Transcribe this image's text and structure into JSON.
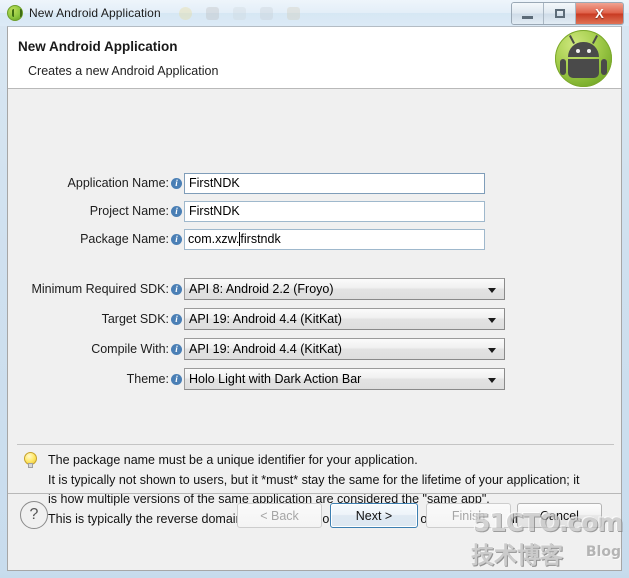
{
  "window": {
    "title": "New Android Application",
    "icon": "android-round-icon",
    "buttons": {
      "minimize": "minimize-icon",
      "maximize": "maximize-icon",
      "close": "X"
    }
  },
  "dialog": {
    "heading": "New Android Application",
    "subheading": "Creates a new Android Application",
    "logo": "android-mascot-logo"
  },
  "fields": [
    {
      "label": "Application Name:",
      "value": "FirstNDK",
      "type": "text",
      "name": "application-name"
    },
    {
      "label": "Project Name:",
      "value": "FirstNDK",
      "type": "text",
      "name": "project-name"
    },
    {
      "label": "Package Name:",
      "value_before_caret": "com.xzw.",
      "value_after_caret": "firstndk",
      "type": "text",
      "name": "package-name"
    }
  ],
  "combos": [
    {
      "label": "Minimum Required SDK:",
      "value": "API 8: Android 2.2 (Froyo)",
      "name": "minimum-required-sdk"
    },
    {
      "label": "Target SDK:",
      "value": "API 19: Android 4.4 (KitKat)",
      "name": "target-sdk"
    },
    {
      "label": "Compile With:",
      "value": "API 19: Android 4.4 (KitKat)",
      "name": "compile-with"
    },
    {
      "label": "Theme:",
      "value": "Holo Light with Dark Action Bar",
      "name": "theme"
    }
  ],
  "hint": {
    "icon": "lightbulb-icon",
    "lines": [
      "The package name must be a unique identifier for your application.",
      "It is typically not shown to users, but it *must* stay the same for the lifetime of your application; it",
      "is how multiple versions of the same application are considered the \"same app\".",
      "This is typically the reverse domain name of your organization plus one or more application"
    ]
  },
  "buttons": {
    "help": "?",
    "back": "< Back",
    "next": "Next >",
    "finish": "Finish",
    "cancel": "Cancel"
  },
  "watermark": {
    "top": "51CTO.com",
    "bottom": "技术博客",
    "blog": "Blog"
  },
  "colors": {
    "accent": "#3c7fb1",
    "info_icon": "#4a7fb5",
    "android_green": "#8cc63e",
    "close_red": "#c83a22"
  }
}
